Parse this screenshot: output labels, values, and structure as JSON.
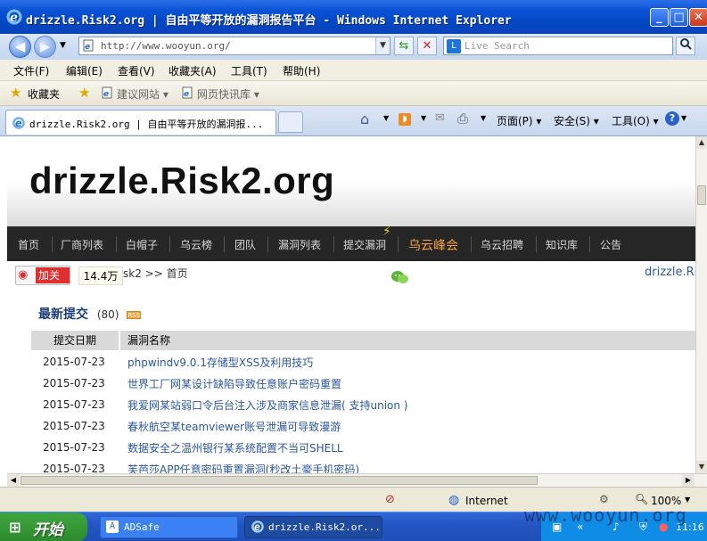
{
  "window": {
    "title": "drizzle.Risk2.org | 自由平等开放的漏洞报告平台 - Windows Internet Explorer",
    "buttons": {
      "minimize": "_",
      "maximize": "□",
      "close": "✕"
    }
  },
  "addressbar": {
    "url": "http://www.wooyun.org/",
    "search_placeholder": "Live Search"
  },
  "menubar": [
    "文件(F)",
    "编辑(E)",
    "查看(V)",
    "收藏夹(A)",
    "工具(T)",
    "帮助(H)"
  ],
  "favbar": {
    "favorites_label": "收藏夹",
    "items": [
      "建议网站 ▾",
      "网页快讯库 ▾"
    ]
  },
  "tabs": {
    "active_label": "drizzle.Risk2.org | 自由平等开放的漏洞报..."
  },
  "commandbar": {
    "page_label": "页面(P) ▾",
    "safety_label": "安全(S) ▾",
    "tools_label": "工具(O) ▾"
  },
  "site": {
    "title": "drizzle.Risk2.org",
    "nav": [
      "首页",
      "厂商列表",
      "白帽子",
      "乌云榜",
      "团队",
      "漏洞列表",
      "提交漏洞",
      "乌云峰会",
      "乌云招聘",
      "知识库",
      "公告"
    ],
    "weibo_follow": "加关注",
    "weibo_count": "14.4万",
    "breadcrumb": "sk2 >> 首页",
    "breadcrumb_right": "drizzle.Ri",
    "latest": {
      "title": "最新提交",
      "count": "(80)",
      "rss": "RSS"
    },
    "table": {
      "headers": [
        "提交日期",
        "漏洞名称"
      ],
      "rows": [
        {
          "date": "2015-07-23",
          "title": "phpwindv9.0.1存储型XSS及利用技巧"
        },
        {
          "date": "2015-07-23",
          "title": "世界工厂网某设计缺陷导致任意账户密码重置"
        },
        {
          "date": "2015-07-23",
          "title": "我爱网某站弱口令后台注入涉及商家信息泄漏( 支持union )"
        },
        {
          "date": "2015-07-23",
          "title": "春秋航空某teamviewer账号泄漏可导致漫游"
        },
        {
          "date": "2015-07-23",
          "title": "数据安全之温州银行某系统配置不当可SHELL"
        },
        {
          "date": "2015-07-23",
          "title": "芙芭莎APP任意密码重置漏洞(秒改土豪手机密码)"
        }
      ]
    }
  },
  "statusbar": {
    "zone": "Internet",
    "zoom": "100%"
  },
  "taskbar": {
    "start": "开始",
    "items": [
      "ADSafe",
      "drizzle.Risk2.or..."
    ],
    "clock": "11:16"
  },
  "watermark": "www.wooyun.org"
}
